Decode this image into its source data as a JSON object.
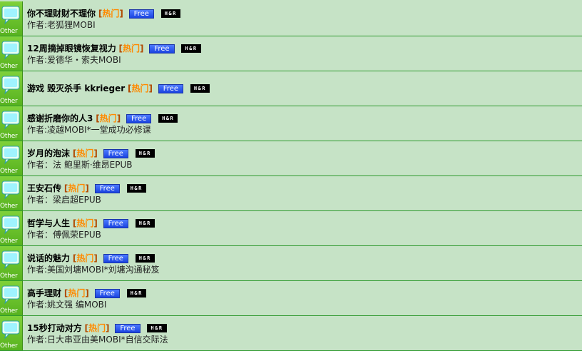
{
  "category_label": "Other",
  "colors": {
    "row_bg": "#c6e3c6",
    "row_border": "#2f9a2f",
    "hot_text": "#ff8a00",
    "free_badge": "#1a43e0",
    "hr_badge": "#000000"
  },
  "items": [
    {
      "title": "你不理财财不理你",
      "hot": "热门",
      "free": "Free",
      "hr": "H&R",
      "author": "作者:老狐狸MOBI"
    },
    {
      "title": "12周摘掉眼镜恢复视力",
      "hot": "热门",
      "free": "Free",
      "hr": "H&R",
      "author": "作者:爱德华・索夫MOBI"
    },
    {
      "title": "游戏 毁灭杀手 kkrieger",
      "hot": "热门",
      "free": "Free",
      "hr": "H&R",
      "author": ""
    },
    {
      "title": "感谢折磨你的人3",
      "hot": "热门",
      "free": "Free",
      "hr": "H&R",
      "author": "作者:凌越MOBI*一堂成功必修课"
    },
    {
      "title": "岁月的泡沫",
      "hot": "热门",
      "free": "Free",
      "hr": "H&R",
      "author": "作者：法 鲍里斯·维昂EPUB"
    },
    {
      "title": "王安石传",
      "hot": "热门",
      "free": "Free",
      "hr": "H&R",
      "author": "作者：梁启超EPUB"
    },
    {
      "title": "哲学与人生",
      "hot": "热门",
      "free": "Free",
      "hr": "H&R",
      "author": "作者：傅佩荣EPUB"
    },
    {
      "title": "说话的魅力",
      "hot": "热门",
      "free": "Free",
      "hr": "H&R",
      "author": "作者:美国刘墉MOBI*刘墉沟通秘笈"
    },
    {
      "title": "高手理财",
      "hot": "热门",
      "free": "Free",
      "hr": "H&R",
      "author": "作者:姚文强 编MOBI"
    },
    {
      "title": "15秒打动对方",
      "hot": "热门",
      "free": "Free",
      "hr": "H&R",
      "author": "作者:日大串亚由美MOBI*自信交际法"
    }
  ]
}
